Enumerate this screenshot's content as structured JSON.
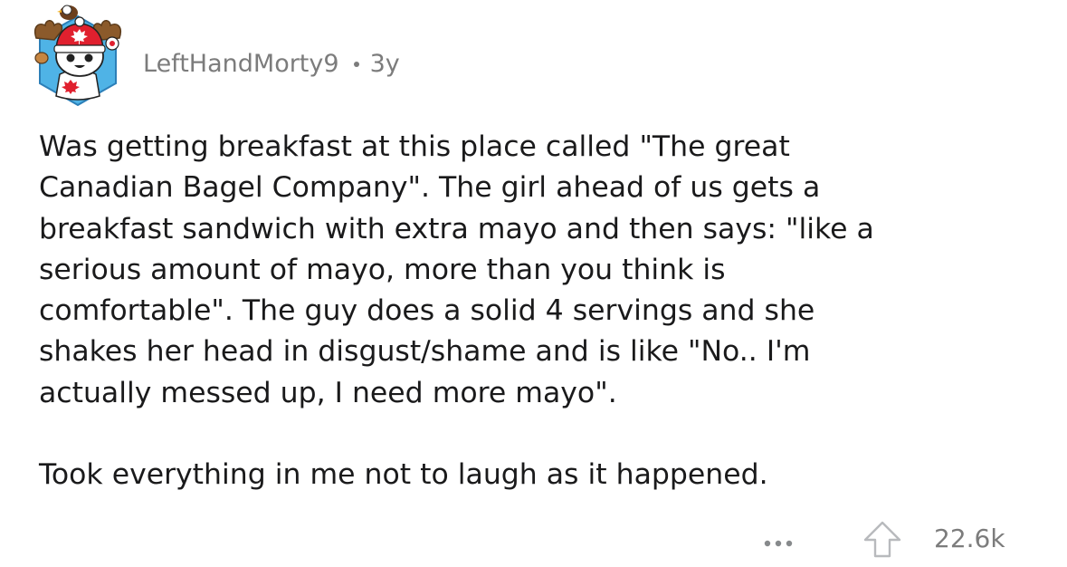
{
  "comment": {
    "author": "LeftHandMorty9",
    "age": "3y",
    "body_lines": [
      "Was getting breakfast at this place called \"The great",
      "Canadian Bagel Company\". The girl ahead of us gets a",
      "breakfast sandwich with extra mayo and then says: \"like a",
      "serious amount of mayo, more than you think is",
      "comfortable\". The guy does a solid 4 servings and she",
      "shakes her head in disgust/shame and is like \"No.. I'm",
      "actually messed up, I need more mayo\"."
    ],
    "body_last": "Took everything in me not to laugh as it happened.",
    "score": "22.6k"
  },
  "icons": {
    "avatar": "snoo-avatar-canada",
    "more": "more-options-icon",
    "upvote": "upvote-arrow-icon"
  },
  "colors": {
    "text": "#1a1a1b",
    "meta": "#7c7c7c",
    "avatar_bg": "#4fb3e6",
    "maple_red": "#e0202e"
  }
}
